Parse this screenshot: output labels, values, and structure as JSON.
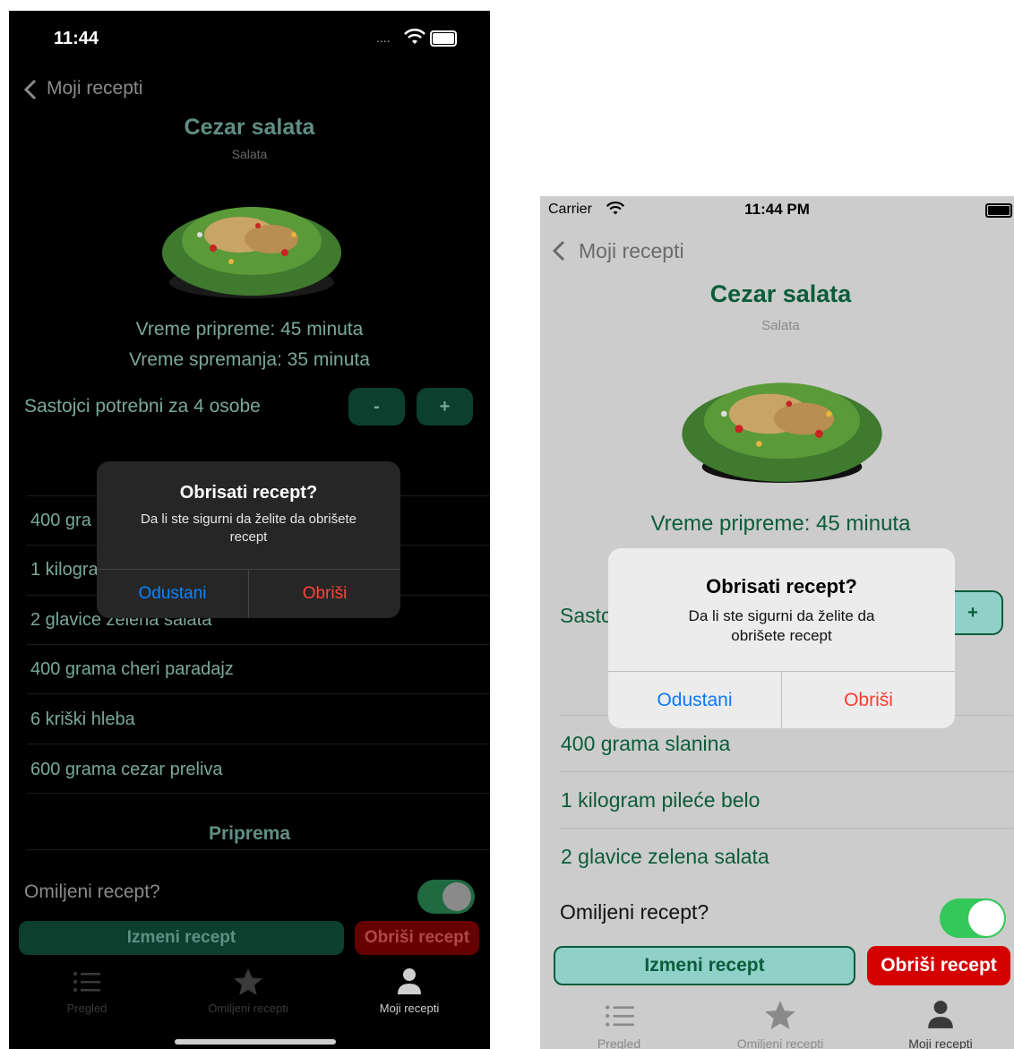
{
  "dark": {
    "status": {
      "time": "11:44",
      "dots": "...."
    },
    "nav": {
      "back_label": "Moji recepti"
    },
    "recipe": {
      "title": "Cezar salata",
      "category": "Salata",
      "prep_time": "Vreme pripreme: 45 minuta",
      "cook_time": "Vreme spremanja: 35 minuta",
      "servings_label": "Sastojci potrebni za 4 osobe",
      "minus": "-",
      "plus": "+"
    },
    "ingredients": [
      "400 grama slanina",
      "1 kilogram pileće belo",
      "2 glavice zelena salata",
      "400 grama cheri paradajz",
      "6 kriški hleba",
      "600 grama cezar preliva"
    ],
    "ingredients_visible": [
      "400 gra",
      "1 kilogra",
      "2 glavice zelena salata",
      "400 grama cheri paradajz",
      "6 kriški hleba",
      "600 grama cezar preliva"
    ],
    "section_preparation": "Priprema",
    "favorite_label": "Omiljeni recept?",
    "edit_button": "Izmeni recept",
    "delete_button": "Obriši recept",
    "alert": {
      "title": "Obrisati recept?",
      "message": "Da li ste sigurni da želite da obrišete recept",
      "cancel": "Odustani",
      "confirm": "Obriši"
    },
    "tabs": [
      {
        "label": "Pregled",
        "icon": "list-icon"
      },
      {
        "label": "Omiljeni recepti",
        "icon": "star-icon"
      },
      {
        "label": "Moji recepti",
        "icon": "person-icon"
      }
    ]
  },
  "light": {
    "status": {
      "carrier": "Carrier",
      "time": "11:44 PM"
    },
    "nav": {
      "back_label": "Moji recepti"
    },
    "recipe": {
      "title": "Cezar salata",
      "category": "Salata",
      "prep_time": "Vreme pripreme: 45 minuta",
      "servings_visible": "Sastc",
      "plus": "+"
    },
    "ingredients": [
      "400 grama slanina",
      "1 kilogram pileće belo",
      "2 glavice zelena salata"
    ],
    "favorite_label": "Omiljeni recept?",
    "edit_button": "Izmeni recept",
    "delete_button": "Obriši recept",
    "alert": {
      "title": "Obrisati recept?",
      "message": "Da li ste sigurni da želite da obrišete recept",
      "cancel": "Odustani",
      "confirm": "Obriši"
    },
    "tabs": [
      {
        "label": "Pregled",
        "icon": "list-icon"
      },
      {
        "label": "Omiljeni recepti",
        "icon": "star-icon"
      },
      {
        "label": "Moji recepti",
        "icon": "person-icon"
      }
    ]
  },
  "colors": {
    "dark_accent": "#0c3f2e",
    "light_accent": "#0b5c3a",
    "light_edit_button": "#8fd0c8",
    "delete_red": "#d40000",
    "alert_blue": "#0a84ff",
    "alert_red": "#ff453a",
    "toggle_green": "#34c759"
  }
}
